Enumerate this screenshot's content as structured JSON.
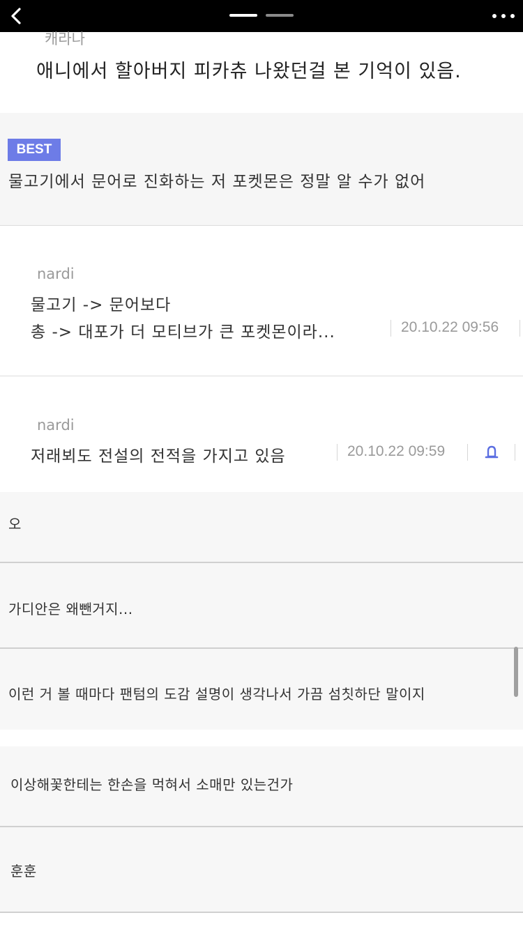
{
  "topbar": {
    "back_icon": "chevron-left-icon",
    "more_icon": "more-dots-icon",
    "page_indicator": {
      "active": 1,
      "total": 2
    }
  },
  "comments": [
    {
      "author": "캐라나",
      "text": "애니에서 할아버지 피카츄 나왔던걸 본 기억이 있음."
    },
    {
      "badge": "BEST",
      "text": "물고기에서 문어로 진화하는 저 포켓몬은 정말 알 수가 없어"
    }
  ],
  "replies": [
    {
      "author": "nardi",
      "line1": "물고기 -> 문어보다",
      "line2": "총 -> 대포가 더 모티브가 큰 포켓몬이라...",
      "time": "20.10.22 09:56"
    },
    {
      "author": "nardi",
      "text": "저래뵈도 전설의 전적을 가지고 있음",
      "time": "20.10.22 09:59",
      "icon": "bell-icon"
    }
  ],
  "rows": [
    "오",
    "가디안은 왜뺀거지...",
    "이런 거 볼 때마다 팬텀의 도감 설명이 생각나서 가끔 섬칫하단 말이지",
    "이상해꽃한테는 한손을 먹혀서 소매만 있는건가",
    "훈훈"
  ],
  "colors": {
    "topbar": "#000000",
    "best_badge": "#6d7ce7",
    "bell": "#5b6ee1",
    "row_bg": "#f7f7f7"
  }
}
